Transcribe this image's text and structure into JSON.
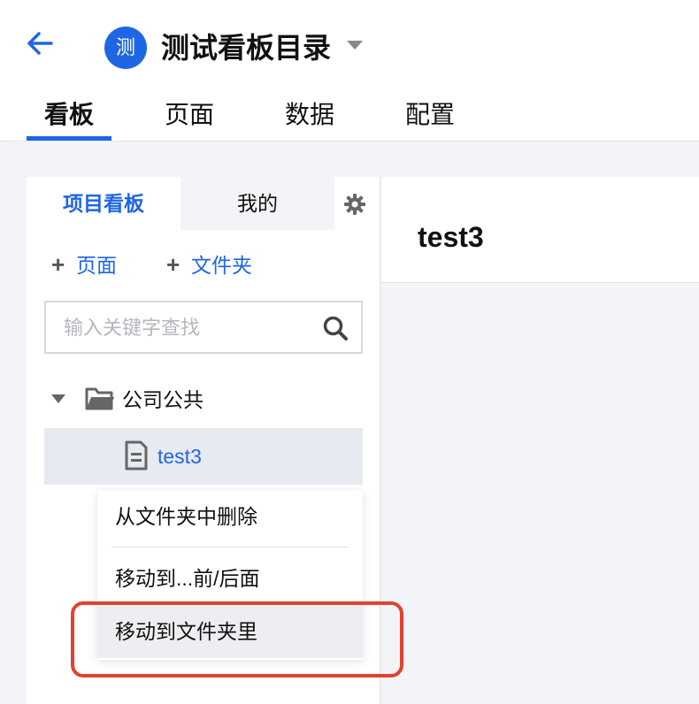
{
  "header": {
    "avatar_char": "测",
    "title": "测试看板目录"
  },
  "tabs": [
    {
      "label": "看板",
      "active": true
    },
    {
      "label": "页面",
      "active": false
    },
    {
      "label": "数据",
      "active": false
    },
    {
      "label": "配置",
      "active": false
    }
  ],
  "panel": {
    "tab_project": "项目看板",
    "tab_mine": "我的",
    "add_page": "页面",
    "add_folder": "文件夹",
    "search_placeholder": "输入关键字查找",
    "folder_name": "公司公共",
    "page_name": "test3"
  },
  "main": {
    "title": "test3"
  },
  "context_menu": {
    "items": [
      "从文件夹中删除",
      "移动到...前/后面",
      "移动到文件夹里"
    ]
  },
  "colors": {
    "accent": "#1f66e5",
    "highlight_border": "#e2422e"
  }
}
